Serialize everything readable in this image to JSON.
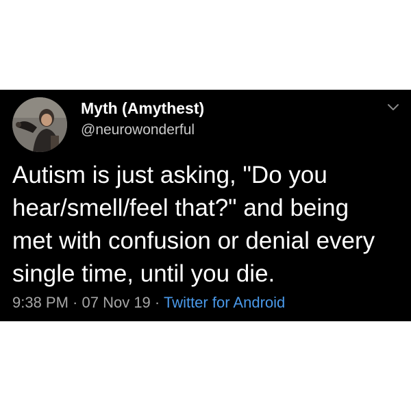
{
  "tweet": {
    "author": {
      "display_name": "Myth (Amythest)",
      "handle": "@neurowonderful"
    },
    "text_lines": [
      "Autism is just asking, \"Do you",
      "hear/smell/feel that?\" and being",
      "met with confusion or denial every",
      "single time, until you die."
    ],
    "time": "9:38 PM",
    "separator": " · ",
    "date": "07 Nov 19",
    "source": "Twitter for Android"
  },
  "icons": {
    "menu": "chevron-down-icon",
    "avatar": "avatar"
  },
  "colors": {
    "card_background": "#000000",
    "page_background": "#ffffff",
    "text_primary": "#ffffff",
    "text_secondary": "#a6a6a6",
    "link": "#4a99e9"
  }
}
